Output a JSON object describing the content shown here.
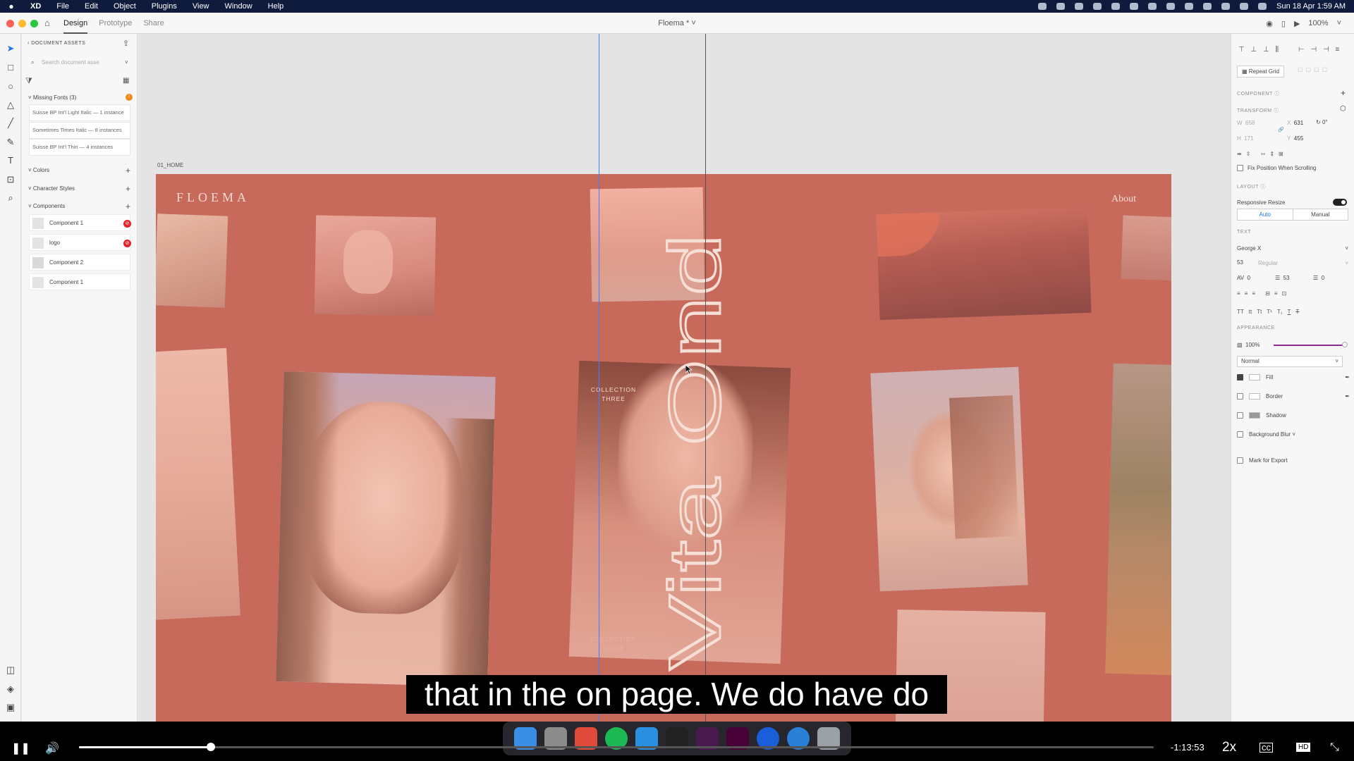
{
  "menubar": {
    "app": "XD",
    "items": [
      "File",
      "Edit",
      "Object",
      "Plugins",
      "View",
      "Window",
      "Help"
    ],
    "clock": "Sun 18 Apr  1:59 AM"
  },
  "titlebar": {
    "tabs": [
      "Design",
      "Prototype",
      "Share"
    ],
    "document": "Floema * ˅",
    "zoom": "100%"
  },
  "assets": {
    "header": "DOCUMENT ASSETS",
    "search_placeholder": "Search document asse",
    "missing_fonts_label": "Missing Fonts (3)",
    "fonts": [
      "Suisse BP Int'l Light Italic — 1 instance",
      "Sometimes Times Italic — 8 instances",
      "Suisse BP Int'l Thin — 4 instances"
    ],
    "colors_label": "Colors",
    "character_styles_label": "Character Styles",
    "components_label": "Components",
    "components": [
      "Component 1",
      "logo",
      "Component 2",
      "Component 1"
    ]
  },
  "canvas": {
    "artboard_label": "01_HOME",
    "logo": "FLOEMA",
    "about": "About",
    "vertical_title": "Vita Ond",
    "collection_three": [
      "COLLECTION",
      "THREE"
    ],
    "collection_four": [
      "COLLECTION",
      "FOUR"
    ],
    "accent": "#c76a5c"
  },
  "props": {
    "repeat_grid": "Repeat Grid",
    "component_label": "COMPONENT",
    "transform_label": "TRANSFORM",
    "w_label": "W",
    "w": "658",
    "h_label": "H",
    "h": "171",
    "x_label": "X",
    "x": "631",
    "y_label": "Y",
    "y": "455",
    "rotation": "0°",
    "fix_position": "Fix Position When Scrolling",
    "layout_label": "LAYOUT",
    "responsive_resize": "Responsive Resize",
    "auto": "Auto",
    "manual": "Manual",
    "text_label": "TEXT",
    "font": "George X",
    "font_size": "53",
    "font_weight": "Regular",
    "char_spacing": "0",
    "line_spacing": "53",
    "para_spacing": "0",
    "appearance_label": "APPEARANCE",
    "opacity": "100%",
    "blend": "Normal",
    "fill": "Fill",
    "border": "Border",
    "shadow": "Shadow",
    "background_blur": "Background Blur ˅",
    "mark_export": "Mark for Export",
    "text_case": [
      "TT",
      "tt",
      "Tt",
      "T¹",
      "T₁",
      "T",
      "T"
    ]
  },
  "caption": "that in the on page. We do have do",
  "player": {
    "time": "-1:13:53",
    "speed": "2x",
    "progress": 0.123
  }
}
